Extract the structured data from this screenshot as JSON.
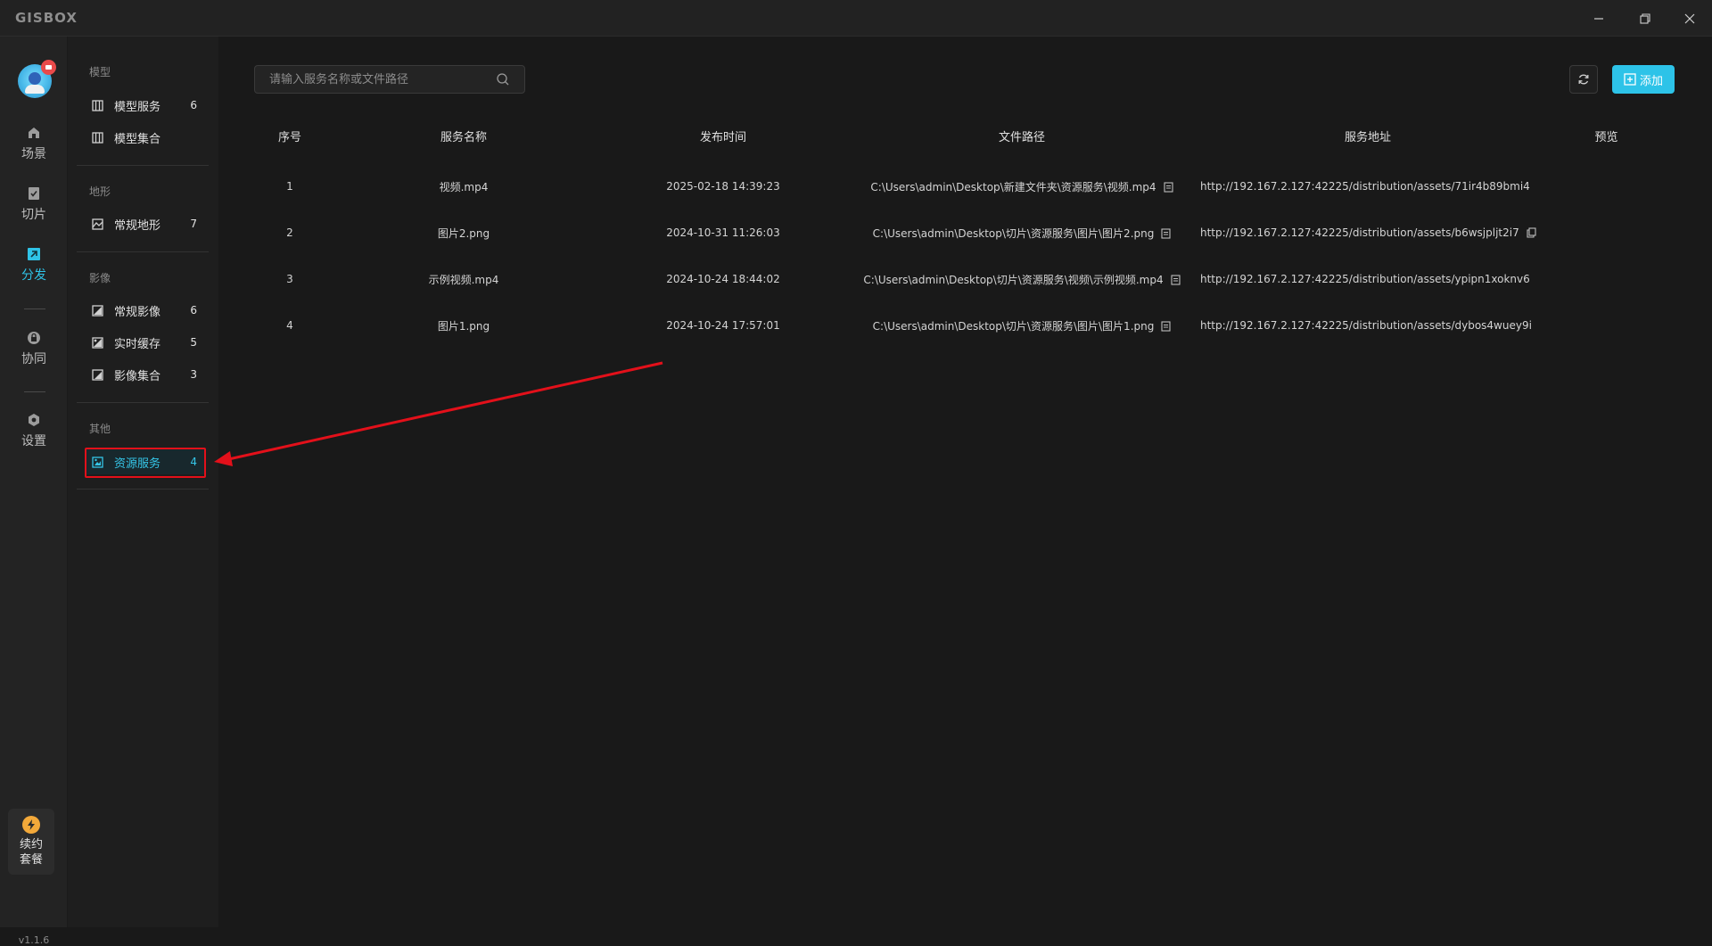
{
  "app": {
    "logo_text": "GISBOX",
    "version": "v1.1.6"
  },
  "rail": {
    "items": [
      {
        "label": "场景",
        "icon": "scene-icon",
        "active": false
      },
      {
        "label": "切片",
        "icon": "slice-icon",
        "active": false
      },
      {
        "label": "分发",
        "icon": "distribute-icon",
        "active": true
      },
      {
        "label": "协同",
        "icon": "collaborate-icon",
        "active": false
      },
      {
        "label": "设置",
        "icon": "settings-icon",
        "active": false
      }
    ],
    "renew": {
      "line1": "续约",
      "line2": "套餐"
    }
  },
  "categories": {
    "groups": [
      {
        "title": "模型",
        "items": [
          {
            "label": "模型服务",
            "count": "6"
          },
          {
            "label": "模型集合",
            "count": ""
          }
        ]
      },
      {
        "title": "地形",
        "items": [
          {
            "label": "常规地形",
            "count": "7"
          }
        ]
      },
      {
        "title": "影像",
        "items": [
          {
            "label": "常规影像",
            "count": "6"
          },
          {
            "label": "实时缓存",
            "count": "5"
          },
          {
            "label": "影像集合",
            "count": "3"
          }
        ]
      },
      {
        "title": "其他",
        "items": [
          {
            "label": "资源服务",
            "count": "4",
            "active": true
          }
        ]
      }
    ]
  },
  "toolbar": {
    "search_placeholder": "请输入服务名称或文件路径",
    "add_label": "添加",
    "accent": "#2dc3e8"
  },
  "table": {
    "headers": [
      "序号",
      "服务名称",
      "发布时间",
      "文件路径",
      "服务地址",
      "预览"
    ],
    "rows": [
      {
        "index": "1",
        "name": "视频.mp4",
        "time": "2025-02-18 14:39:23",
        "path": "C:\\Users\\admin\\Desktop\\新建文件夹\\资源服务\\视频.mp4",
        "url": "http://192.167.2.127:42225/distribution/assets/71ir4b89bmi4"
      },
      {
        "index": "2",
        "name": "图片2.png",
        "time": "2024-10-31 11:26:03",
        "path": "C:\\Users\\admin\\Desktop\\切片\\资源服务\\图片\\图片2.png",
        "url": "http://192.167.2.127:42225/distribution/assets/b6wsjpljt2i7"
      },
      {
        "index": "3",
        "name": "示例视频.mp4",
        "time": "2024-10-24 18:44:02",
        "path": "C:\\Users\\admin\\Desktop\\切片\\资源服务\\视频\\示例视频.mp4",
        "url": "http://192.167.2.127:42225/distribution/assets/ypipn1xoknv6"
      },
      {
        "index": "4",
        "name": "图片1.png",
        "time": "2024-10-24 17:57:01",
        "path": "C:\\Users\\admin\\Desktop\\切片\\资源服务\\图片\\图片1.png",
        "url": "http://192.167.2.127:42225/distribution/assets/dybos4wuey9i"
      }
    ]
  }
}
